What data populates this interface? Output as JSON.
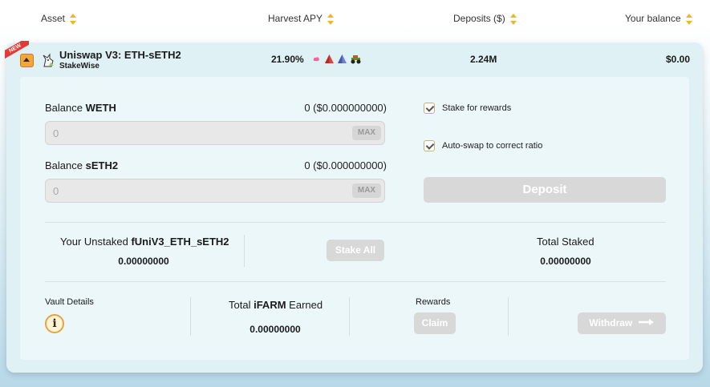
{
  "header": {
    "asset": "Asset",
    "apy": "Harvest APY",
    "deposits": "Deposits ($)",
    "balance": "Your balance"
  },
  "vault": {
    "badge": "NEW",
    "name": "Uniswap V3: ETH-sETH2",
    "platform": "StakeWise",
    "apy": "21.90%",
    "apy_icons": [
      "uniswap-icon",
      "red-triangle-icon",
      "blue-triangle-icon",
      "tractor-icon"
    ],
    "deposits": "2.24M",
    "your_balance": "$0.00"
  },
  "deposit_form": {
    "balance1_prefix": "Balance",
    "balance1_token": "WETH",
    "balance1_amount": "0 ($0.000000000)",
    "input1_placeholder": "0",
    "max_label": "MAX",
    "balance2_prefix": "Balance",
    "balance2_token": "sETH2",
    "balance2_amount": "0 ($0.000000000)",
    "input2_placeholder": "0",
    "stake_checkbox": "Stake for rewards",
    "autoswap_checkbox": "Auto-swap to correct ratio",
    "deposit_button": "Deposit"
  },
  "staking": {
    "unstaked_prefix": "Your Unstaked",
    "unstaked_token": "fUniV3_ETH_sETH2",
    "unstaked_value": "0.00000000",
    "stake_all_button": "Stake All",
    "total_staked_label": "Total Staked",
    "total_staked_value": "0.00000000"
  },
  "footer": {
    "vault_details": "Vault Details",
    "earned_prefix": "Total",
    "earned_token": "iFARM",
    "earned_suffix": "Earned",
    "earned_value": "0.00000000",
    "rewards_label": "Rewards",
    "claim_button": "Claim",
    "withdraw_button": "Withdraw"
  },
  "colors": {
    "accent": "#f0b429",
    "card_bg": "#dff1f5",
    "panel_bg": "#ecf7f9",
    "button_disabled": "#d8d8d8"
  }
}
